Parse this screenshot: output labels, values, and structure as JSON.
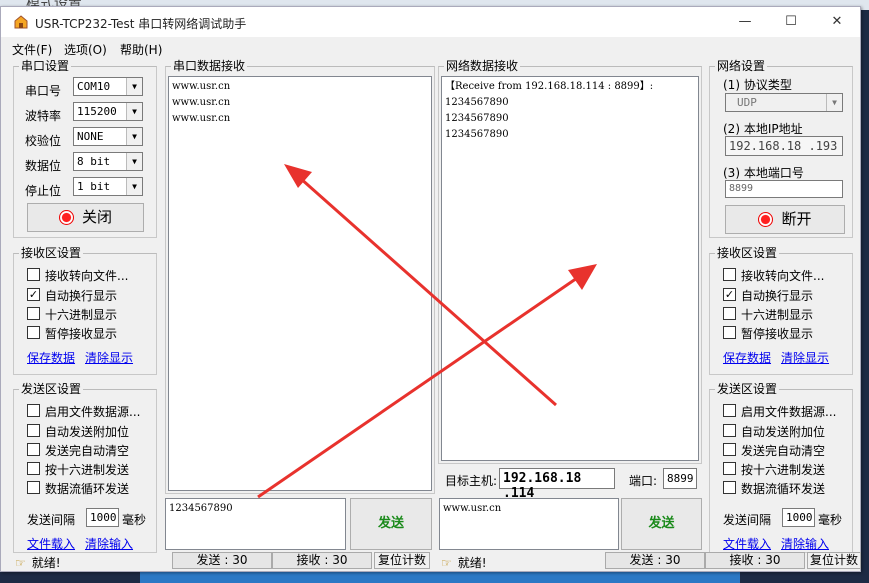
{
  "window": {
    "title": "USR-TCP232-Test 串口转网络调试助手",
    "bg_title": "模式设置"
  },
  "menu": [
    "文件(F)",
    "选项(O)",
    "帮助(H)"
  ],
  "serial_settings": {
    "title": "串口设置",
    "rows": [
      {
        "label": "串口号",
        "value": "COM10"
      },
      {
        "label": "波特率",
        "value": "115200"
      },
      {
        "label": "校验位",
        "value": "NONE"
      },
      {
        "label": "数据位",
        "value": "8 bit"
      },
      {
        "label": "停止位",
        "value": "1 bit"
      }
    ],
    "close_label": "关闭"
  },
  "left_recv": {
    "title": "接收区设置",
    "options": [
      {
        "label": "接收转向文件...",
        "checked": false
      },
      {
        "label": "自动换行显示",
        "checked": true
      },
      {
        "label": "十六进制显示",
        "checked": false
      },
      {
        "label": "暂停接收显示",
        "checked": false
      }
    ],
    "save_link": "保存数据",
    "clear_link": "清除显示"
  },
  "left_send": {
    "title": "发送区设置",
    "options": [
      {
        "label": "启用文件数据源...",
        "checked": false
      },
      {
        "label": "自动发送附加位",
        "checked": false
      },
      {
        "label": "发送完自动清空",
        "checked": false
      },
      {
        "label": "按十六进制发送",
        "checked": false
      },
      {
        "label": "数据流循环发送",
        "checked": false
      }
    ],
    "interval_label": "发送间隔",
    "interval_value": "1000",
    "interval_unit": "毫秒",
    "load_link": "文件载入",
    "clear_link": "清除输入"
  },
  "serial_recv": {
    "title": "串口数据接收",
    "lines": [
      "www.usr.cn",
      "www.usr.cn",
      "www.usr.cn"
    ]
  },
  "net_recv": {
    "title": "网络数据接收",
    "lines": [
      "【Receive from 192.168.18.114 : 8899】:",
      "1234567890",
      "1234567890",
      "1234567890"
    ]
  },
  "target": {
    "host_label": "目标主机:",
    "host_value": "192.168.18 .114",
    "port_label": "端口:",
    "port_value": "8899"
  },
  "serial_send": {
    "text": "1234567890",
    "button": "发送"
  },
  "net_send": {
    "text": "www.usr.cn",
    "button": "发送"
  },
  "net_settings": {
    "title": "网络设置",
    "protocol_label": "(1) 协议类型",
    "protocol_value": "UDP",
    "ip_label": "(2) 本地IP地址",
    "ip_value": "192.168.18 .193",
    "port_label": "(3) 本地端口号",
    "port_value": "8899",
    "disconnect_label": "断开"
  },
  "right_recv": {
    "title": "接收区设置",
    "options": [
      {
        "label": "接收转向文件...",
        "checked": false
      },
      {
        "label": "自动换行显示",
        "checked": true
      },
      {
        "label": "十六进制显示",
        "checked": false
      },
      {
        "label": "暂停接收显示",
        "checked": false
      }
    ],
    "save_link": "保存数据",
    "clear_link": "清除显示"
  },
  "right_send": {
    "title": "发送区设置",
    "options": [
      {
        "label": "启用文件数据源...",
        "checked": false
      },
      {
        "label": "自动发送附加位",
        "checked": false
      },
      {
        "label": "发送完自动清空",
        "checked": false
      },
      {
        "label": "按十六进制发送",
        "checked": false
      },
      {
        "label": "数据流循环发送",
        "checked": false
      }
    ],
    "interval_label": "发送间隔",
    "interval_value": "1000",
    "interval_unit": "毫秒",
    "load_link": "文件载入",
    "clear_link": "清除输入"
  },
  "status_left": {
    "ready": "就绪!",
    "sent": "发送 : 30",
    "recv": "接收 : 30",
    "reset": "复位计数"
  },
  "status_right": {
    "ready": "就绪!",
    "sent": "发送 : 30",
    "recv": "接收 : 30",
    "reset": "复位计数"
  },
  "colors": {
    "arrow": "#e8322d",
    "link": "#0000ee",
    "send_text": "#1a8a1a",
    "icon_red": "#ff2020"
  }
}
